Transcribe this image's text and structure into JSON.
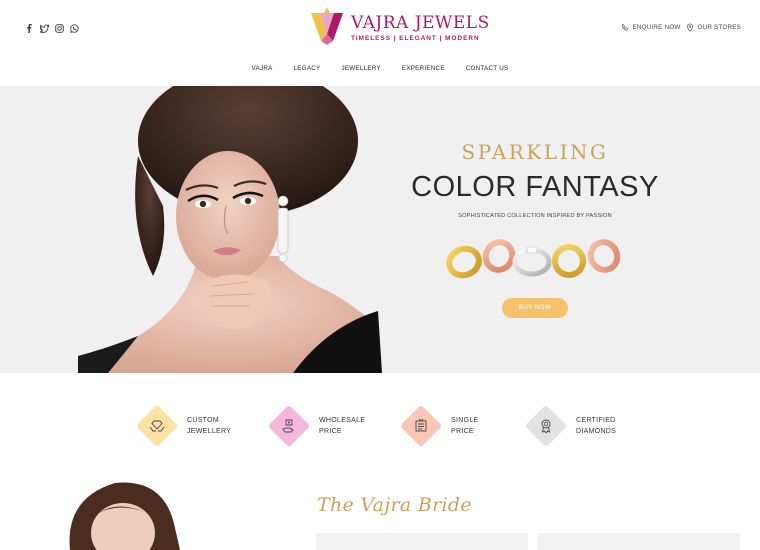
{
  "brand": {
    "name": "VAJRA JEWELS",
    "tagline": "TIMELESS | ELEGANT | MODERN",
    "primary_color": "#b0186a",
    "gold_color": "#c9a25b"
  },
  "social_icons": [
    "facebook-icon",
    "twitter-icon",
    "instagram-icon",
    "whatsapp-icon"
  ],
  "header_links": {
    "enquire": "ENQUIRE NOW",
    "stores": "OUR STORES"
  },
  "nav": {
    "items": [
      "VAJRA",
      "LEGACY",
      "JEWELLERY",
      "EXPERIENCE",
      "CONTACT US"
    ]
  },
  "hero": {
    "kicker": "SPARKLING",
    "title": "COLOR FANTASY",
    "subtitle": "SOPHISTICATED COLLECTION INSPIRED BY PASSION",
    "button": "BUY NOW",
    "button_color": "#f4c26b"
  },
  "features": [
    {
      "line1": "CUSTOM",
      "line2": "JEWELLERY",
      "icon": "hands-diamond-icon",
      "color": "#fbe1a6"
    },
    {
      "line1": "WHOLESALE",
      "line2": "PRICE",
      "icon": "price-tag-hand-icon",
      "color": "#f6b7dd"
    },
    {
      "line1": "SINGLE",
      "line2": "PRICE",
      "icon": "price-board-icon",
      "color": "#f9c6b8"
    },
    {
      "line1": "CERTIFIED",
      "line2": "DIAMONDS",
      "icon": "certificate-badge-icon",
      "color": "#e2e2e2"
    }
  ],
  "bride": {
    "title": "The Vajra Bride"
  }
}
